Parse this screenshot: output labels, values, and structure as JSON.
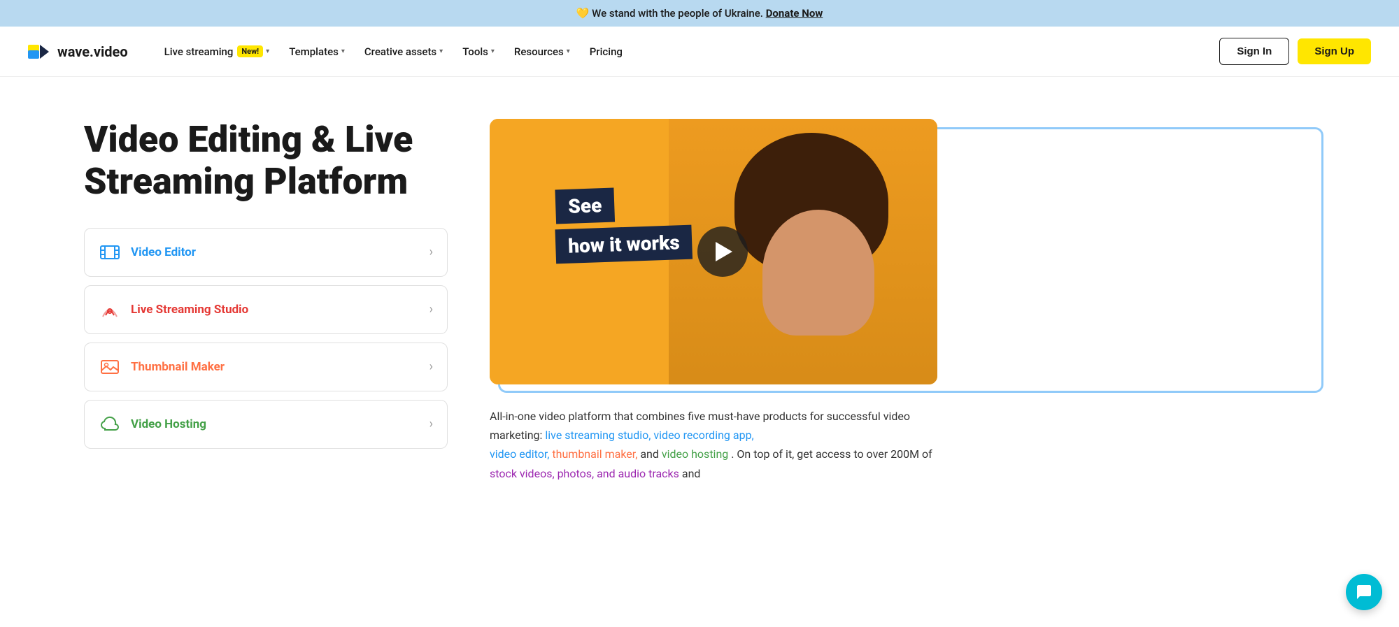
{
  "banner": {
    "emoji": "💛",
    "text": "We stand with the people of Ukraine.",
    "cta": "Donate Now",
    "color": "#b8d9f0"
  },
  "navbar": {
    "logo_text": "wave.video",
    "nav_items": [
      {
        "label": "Live streaming",
        "has_badge": true,
        "badge_text": "New!",
        "has_chevron": true
      },
      {
        "label": "Templates",
        "has_badge": false,
        "has_chevron": true
      },
      {
        "label": "Creative assets",
        "has_badge": false,
        "has_chevron": true
      },
      {
        "label": "Tools",
        "has_badge": false,
        "has_chevron": true
      },
      {
        "label": "Resources",
        "has_badge": false,
        "has_chevron": true
      },
      {
        "label": "Pricing",
        "has_badge": false,
        "has_chevron": false
      }
    ],
    "sign_in": "Sign In",
    "sign_up": "Sign Up"
  },
  "hero": {
    "title": "Video Editing & Live Streaming Platform",
    "features": [
      {
        "label": "Video Editor",
        "color": "blue",
        "icon": "film"
      },
      {
        "label": "Live Streaming Studio",
        "color": "red",
        "icon": "broadcast"
      },
      {
        "label": "Thumbnail Maker",
        "color": "orange",
        "icon": "image"
      },
      {
        "label": "Video Hosting",
        "color": "green",
        "icon": "cloud"
      }
    ]
  },
  "video": {
    "overlay_line1": "See",
    "overlay_line2": "how it works"
  },
  "description": {
    "text_before": "All-in-one video platform that combines five must-have products for successful video marketing:",
    "links": [
      {
        "text": "live streaming studio, video recording app,",
        "color": "blue"
      },
      {
        "text": "video editor,",
        "color": "blue"
      },
      {
        "text": "thumbnail maker,",
        "color": "orange"
      },
      {
        "text": "and",
        "color": "plain"
      },
      {
        "text": "video hosting",
        "color": "green"
      }
    ],
    "text_after": ". On top of it, get access to over 200M of",
    "stock_text": "stock videos, photos, and audio tracks",
    "and_text": "and"
  },
  "chat": {
    "icon": "💬"
  }
}
